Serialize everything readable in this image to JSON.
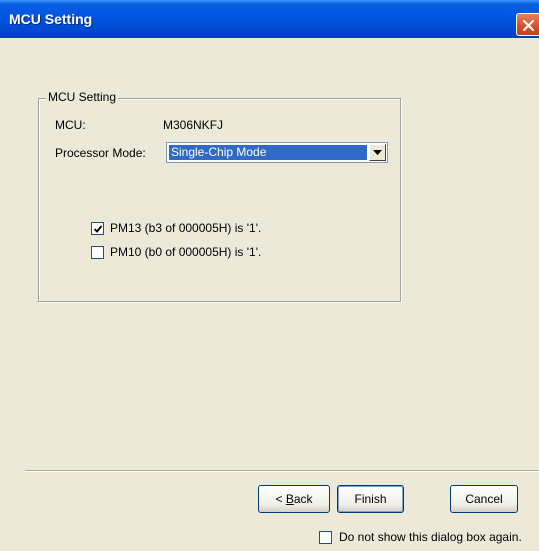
{
  "window": {
    "title": "MCU Setting"
  },
  "group": {
    "label": "MCU Setting"
  },
  "mcu": {
    "label": "MCU:",
    "value": "M306NKFJ"
  },
  "processor_mode": {
    "label": "Processor Mode:",
    "selected": "Single-Chip Mode"
  },
  "checkboxes": [
    {
      "label": "PM13 (b3 of 000005H) is '1'.",
      "checked": true
    },
    {
      "label": "PM10 (b0 of 000005H) is '1'.",
      "checked": false
    }
  ],
  "buttons": {
    "back_mnemonic": "B",
    "back_rest": "ack",
    "back_prefix": "< ",
    "finish": "Finish",
    "cancel": "Cancel"
  },
  "footer": {
    "dont_show_label": "Do not show this dialog box again.",
    "dont_show_checked": false
  },
  "colors": {
    "titlebar": "#0054E3",
    "selection": "#316AC5",
    "dialog_bg": "#ECE9D8"
  }
}
